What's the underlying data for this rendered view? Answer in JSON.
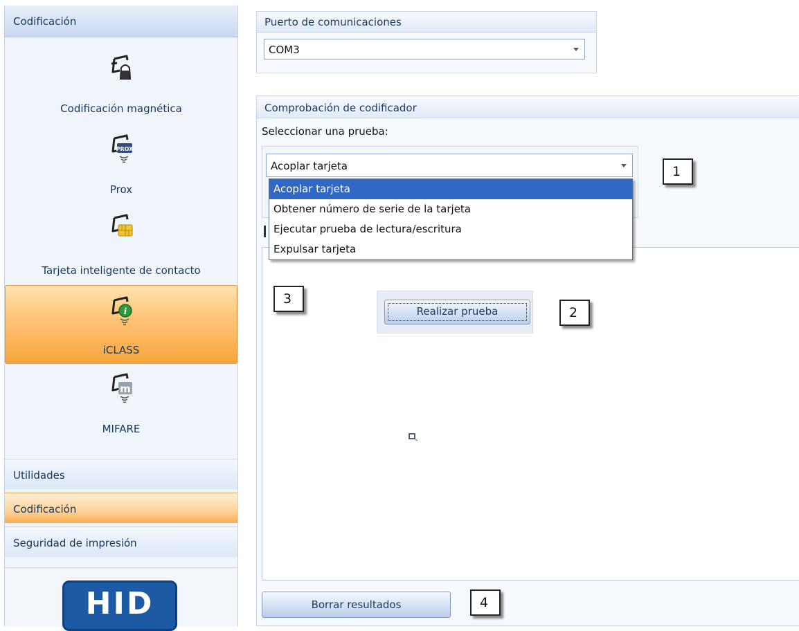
{
  "nav": {
    "header": "Codificación",
    "items": [
      {
        "label": "Codificación magnética",
        "icon": "magnetic-card-icon"
      },
      {
        "label": "Prox",
        "icon": "prox-card-icon",
        "badge": "PROX"
      },
      {
        "label": "Tarjeta inteligente de contacto",
        "icon": "smart-chip-card-icon"
      },
      {
        "label": "iCLASS",
        "icon": "iclass-card-icon",
        "badge": "i",
        "selected": true
      },
      {
        "label": "MIFARE",
        "icon": "mifare-card-icon",
        "badge": "m"
      }
    ],
    "bands": [
      {
        "label": "Utilidades",
        "active": false
      },
      {
        "label": "Codificación",
        "active": true
      },
      {
        "label": "Seguridad de impresión",
        "active": false
      }
    ],
    "logo_text": "HID"
  },
  "port_group": {
    "title": "Puerto de comunicaciones",
    "selected": "COM3"
  },
  "test_group": {
    "title": "Comprobación de codificador",
    "select_label": "Seleccionar una prueba:",
    "selected": "Acoplar tarjeta",
    "options": [
      "Acoplar tarjeta",
      "Obtener número de serie de la tarjeta",
      "Ejecutar prueba de lectura/escritura",
      "Expulsar tarjeta"
    ],
    "highlighted_index": 0,
    "run_button": "Realizar prueba",
    "clear_button": "Borrar resultados"
  },
  "callouts": [
    "1",
    "2",
    "3",
    "4"
  ],
  "colors": {
    "selection_blue": "#3168c6",
    "nav_selected_orange": "#f7a53c",
    "hid_blue": "#1c5aa6"
  }
}
